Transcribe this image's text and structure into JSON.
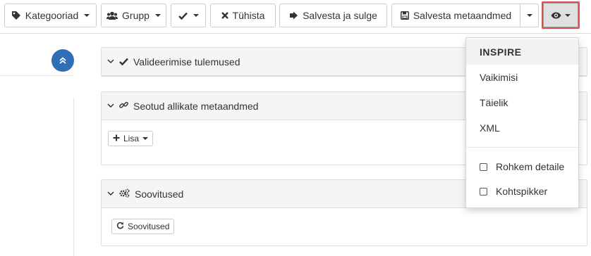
{
  "toolbar": {
    "categories_label": "Kategooriad",
    "group_label": "Grupp",
    "cancel_label": "Tühista",
    "save_close_label": "Salvesta ja sulge",
    "save_metadata_label": "Salvesta metaandmed"
  },
  "panels": {
    "validation_title": "Valideerimise tulemused",
    "linked_title": "Seotud allikate metaandmed",
    "add_label": "Lisa",
    "suggestions_title": "Soovitused",
    "suggestions_button": "Soovitused"
  },
  "view_menu": {
    "items": [
      "INSPIRE",
      "Vaikimisi",
      "Täielik",
      "XML"
    ],
    "selected": "INSPIRE",
    "options": [
      {
        "label": "Rohkem detaile",
        "checked": false
      },
      {
        "label": "Kohtspikker",
        "checked": false
      }
    ]
  },
  "colors": {
    "highlight": "#d9534f",
    "accent": "#2e6fb6"
  }
}
